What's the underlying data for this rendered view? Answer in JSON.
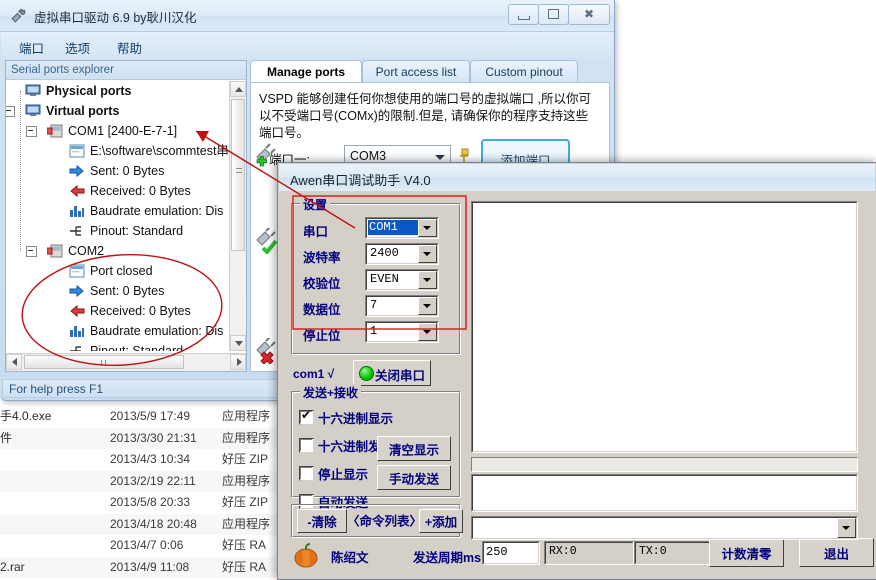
{
  "vspd": {
    "title": "虚拟串口驱动 6.9 by耿川汉化",
    "app_icon": "plug-icon",
    "window_buttons": {
      "minimize": "minimize-icon",
      "maximize": "maximize-icon",
      "close": "close-icon"
    },
    "menu": [
      {
        "label": "端口",
        "name": "menu-port"
      },
      {
        "label": "选项",
        "name": "menu-option"
      },
      {
        "label": "帮助",
        "name": "menu-help"
      }
    ],
    "explorer_header": "Serial ports explorer",
    "tree": [
      {
        "label": "Physical ports",
        "icon": "monitor-icon",
        "indent": 0,
        "bold": true,
        "expander": false
      },
      {
        "label": "Virtual ports",
        "icon": "monitor-icon",
        "indent": 0,
        "bold": true,
        "expander": true
      },
      {
        "label": "COM1 [2400-E-7-1]",
        "icon": "port-icon",
        "indent": 1,
        "bold": false,
        "expander": true
      },
      {
        "label": "E:\\software\\scommtest串",
        "icon": "window-icon",
        "indent": 2,
        "bold": false,
        "expander": false
      },
      {
        "label": "Sent: 0 Bytes",
        "icon": "arrow-right-icon",
        "indent": 2,
        "bold": false,
        "expander": false
      },
      {
        "label": "Received: 0 Bytes",
        "icon": "arrow-left-icon",
        "indent": 2,
        "bold": false,
        "expander": false
      },
      {
        "label": "Baudrate emulation: Dis",
        "icon": "bars-icon",
        "indent": 2,
        "bold": false,
        "expander": false
      },
      {
        "label": "Pinout: Standard",
        "icon": "pinout-icon",
        "indent": 2,
        "bold": false,
        "expander": false
      },
      {
        "label": "COM2",
        "icon": "port-icon",
        "indent": 1,
        "bold": false,
        "expander": true
      },
      {
        "label": "Port closed",
        "icon": "window-icon",
        "indent": 2,
        "bold": false,
        "expander": false
      },
      {
        "label": "Sent: 0 Bytes",
        "icon": "arrow-right-icon",
        "indent": 2,
        "bold": false,
        "expander": false
      },
      {
        "label": "Received: 0 Bytes",
        "icon": "arrow-left-icon",
        "indent": 2,
        "bold": false,
        "expander": false
      },
      {
        "label": "Baudrate emulation: Dis",
        "icon": "bars-icon",
        "indent": 2,
        "bold": false,
        "expander": false
      },
      {
        "label": "Pinout: Standard",
        "icon": "pinout-icon",
        "indent": 2,
        "bold": false,
        "expander": false
      }
    ],
    "tabs": [
      {
        "label": "Manage ports",
        "active": true
      },
      {
        "label": "Port access list",
        "active": false
      },
      {
        "label": "Custom pinout",
        "active": false
      }
    ],
    "description": "VSPD 能够创建任何你想使用的端口号的虚拟端口 ,所以你可以不受端口号(COMx)的限制.但是, 请确保你的程序支持这些端口号。",
    "port_label": "端口一:",
    "port_value": "COM3",
    "add_port_button": "添加端口",
    "actions": [
      {
        "name": "add-port-action-icon",
        "label": "add"
      },
      {
        "name": "apply-port-action-icon",
        "label": "apply"
      },
      {
        "name": "delete-port-action-icon",
        "label": "delete"
      }
    ],
    "status": "For help press F1"
  },
  "awen": {
    "title": "Awen串口调试助手 V4.0",
    "settings_group": "设置",
    "settings": [
      {
        "label": "串口",
        "value": "COM1",
        "selected": true
      },
      {
        "label": "波特率",
        "value": "2400",
        "selected": false
      },
      {
        "label": "校验位",
        "value": "EVEN",
        "selected": false
      },
      {
        "label": "数据位",
        "value": "7",
        "selected": false
      },
      {
        "label": "停止位",
        "value": "1",
        "selected": false
      }
    ],
    "com_status": "com1 √",
    "close_port_button": "关闭串口",
    "close_port_indicator_color": "#00c400",
    "sr_group": "发送+接收",
    "checkboxes": [
      {
        "label": "十六进制显示",
        "checked": true
      },
      {
        "label": "十六进制发送",
        "checked": false
      },
      {
        "label": "停止显示",
        "checked": false
      },
      {
        "label": "自动发送",
        "checked": false
      }
    ],
    "clear_display_button": "清空显示",
    "manual_send_button": "手动发送",
    "cmd_clear_button": "-清除",
    "cmd_list_button": "〈命令列表〉",
    "cmd_add_button": "+添加",
    "author_icon": "pumpkin-icon",
    "author_name": "陈绍文",
    "period_label": "发送周期ms",
    "period_value": "250",
    "rx_label": "RX:0",
    "tx_label": "TX:0",
    "reset_counter_button": "计数清零",
    "exit_button": "退出",
    "recv_text": "",
    "send_text": "",
    "cmd_combo_value": ""
  },
  "explorer": {
    "rows": [
      {
        "name": "手4.0.exe",
        "date": "2013/5/9 17:49",
        "type": "应用程序"
      },
      {
        "name": "件",
        "date": "2013/3/30 21:31",
        "type": "应用程序"
      },
      {
        "name": "",
        "date": "2013/4/3 10:34",
        "type": "好压 ZIP"
      },
      {
        "name": "",
        "date": "2013/2/19 22:11",
        "type": "应用程序"
      },
      {
        "name": "",
        "date": "2013/5/8 20:33",
        "type": "好压 ZIP"
      },
      {
        "name": "",
        "date": "2013/4/18 20:48",
        "type": "应用程序"
      },
      {
        "name": "",
        "date": "2013/4/7 0:06",
        "type": "好压 RA"
      },
      {
        "name": "2.rar",
        "date": "2013/4/9 11:08",
        "type": "好压 RA"
      }
    ]
  },
  "annotations": {
    "ellipse_color": "#c01010",
    "arrow_color": "#c01010"
  }
}
